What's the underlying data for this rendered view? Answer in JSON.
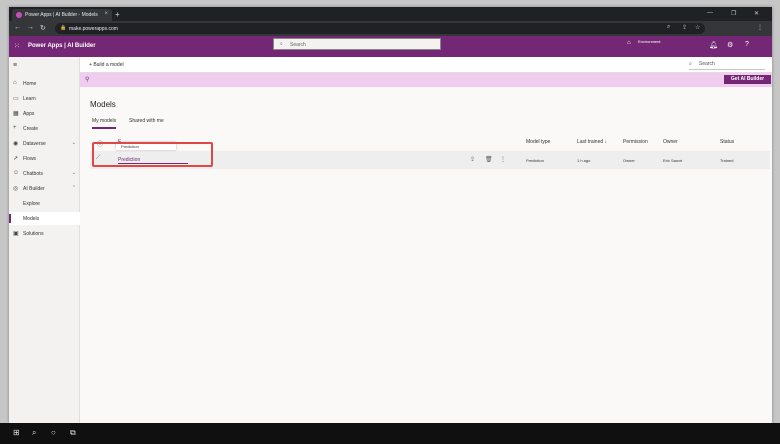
{
  "browser": {
    "tab_title": "Power Apps | AI Builder - Models",
    "tab_close": "×",
    "new_tab": "+",
    "url": "make.powerapps.com",
    "window_controls": [
      "—",
      "❐",
      "✕"
    ]
  },
  "header": {
    "brand": "Power Apps  |  AI Builder",
    "search_placeholder": "Search",
    "environment_label": "Environment",
    "icons": [
      "environment-icon",
      "bell-icon",
      "gear-icon",
      "help-icon"
    ],
    "help_label": "?"
  },
  "commandbar": {
    "build_model": "Build a model",
    "search_placeholder": "Search"
  },
  "banner": {
    "button": "Get AI Builder"
  },
  "nav": {
    "items": [
      {
        "label": "Home",
        "icon": "home-icon"
      },
      {
        "label": "Learn",
        "icon": "book-icon"
      },
      {
        "label": "Apps",
        "icon": "apps-icon"
      },
      {
        "label": "Create",
        "icon": "plus-icon"
      },
      {
        "label": "Dataverse",
        "icon": "database-icon"
      },
      {
        "label": "Flows",
        "icon": "flow-icon"
      },
      {
        "label": "Chatbots",
        "icon": "chatbot-icon"
      },
      {
        "label": "AI Builder",
        "icon": "ai-icon"
      },
      {
        "label": "Explore"
      },
      {
        "label": "Models"
      },
      {
        "label": "Solutions",
        "icon": "solutions-icon"
      }
    ],
    "selected": "Models"
  },
  "page": {
    "title": "Models",
    "tabs": [
      "My models",
      "Shared with me"
    ],
    "active_tab": "My models",
    "columns": {
      "name": "F",
      "model_type": "Model type",
      "last_trained": "Last trained ↓",
      "permission": "Permission",
      "owner": "Owner",
      "status": "Status"
    },
    "rows": [
      {
        "name": "Prediction",
        "model_type": "Prediction",
        "last_trained": "1 h ago",
        "permission": "Owner",
        "owner": "Eric Sauvé",
        "status": "Trained"
      }
    ],
    "tooltip": "Prediction"
  },
  "colors": {
    "brand_purple": "#742774",
    "banner_pink": "#f0cdef",
    "highlight_red": "#e04848"
  }
}
